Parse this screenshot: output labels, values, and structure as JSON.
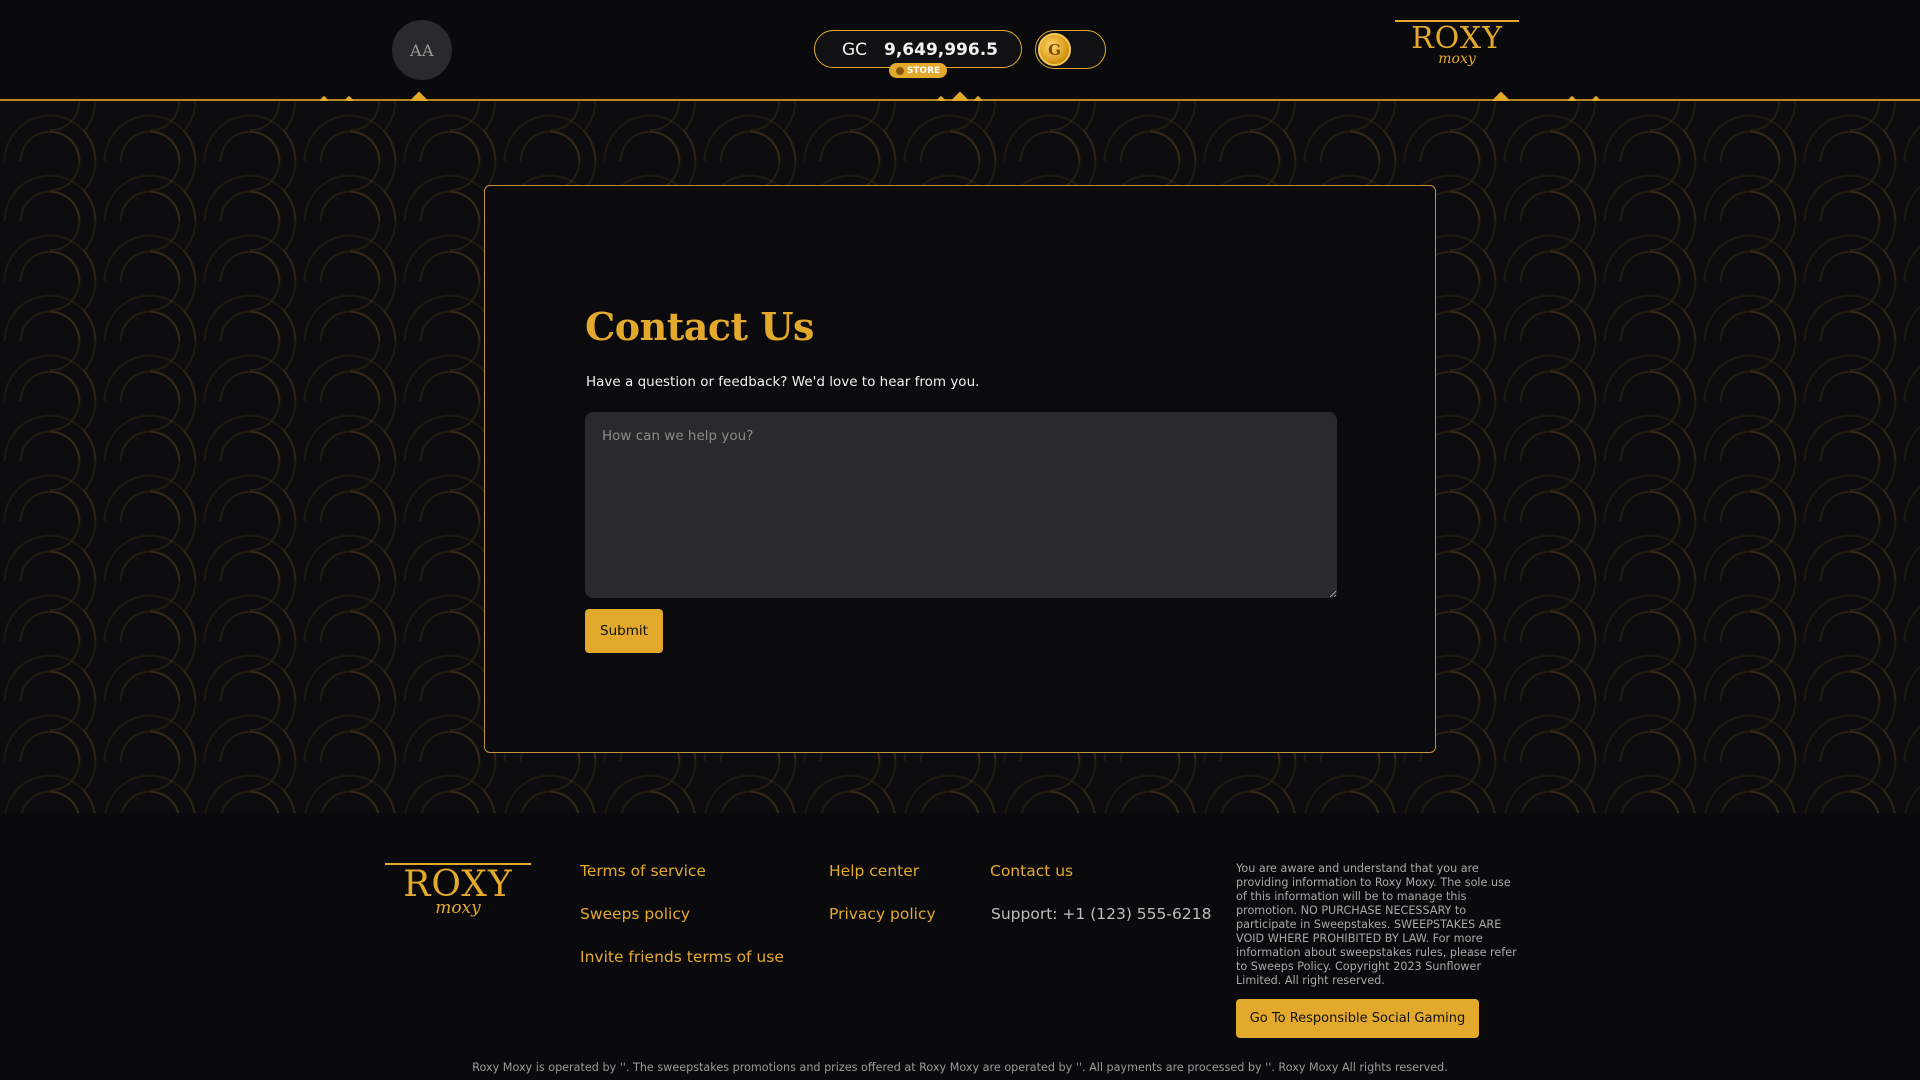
{
  "header": {
    "avatar_initials": "AA",
    "balance": {
      "currency": "GC",
      "value": "9,649,996.5",
      "store_label": "STORE"
    },
    "toggle_coin_letter": "G",
    "logo": {
      "top": "ROXY",
      "bottom": "moxy"
    }
  },
  "contact": {
    "title": "Contact Us",
    "subtitle": "Have a question or feedback? We'd love to hear from you.",
    "message_placeholder": "How can we help you?",
    "submit_label": "Submit"
  },
  "footer": {
    "logo": {
      "top": "ROXY",
      "bottom": "moxy"
    },
    "links": {
      "terms_of_service": "Terms of service",
      "sweeps_policy": "Sweeps policy",
      "invite_friends_terms": "Invite friends terms of use",
      "help_center": "Help center",
      "privacy_policy": "Privacy policy",
      "contact_us": "Contact us"
    },
    "support": "Support: +1 (123) 555-6218",
    "disclaimer": "You are aware and understand that you are providing information to Roxy Moxy. The sole use of this information will be to manage this promotion. NO PURCHASE NECESSARY to participate in Sweepstakes. SWEEPSTAKES ARE VOID WHERE PROHIBITED BY LAW. For more information about sweepstakes rules, please refer to Sweeps Policy. Copyright 2023 Sunflower Limited. All right reserved.",
    "responsible_gaming_label": "Go To Responsible Social Gaming",
    "legal": "Roxy Moxy is operated by ''. The sweepstakes promotions and prizes offered at Roxy Moxy are operated by ''. All payments are processed by ''. Roxy Moxy All rights reserved."
  },
  "colors": {
    "accent": "#e3a92c",
    "background": "#0a0a0c",
    "input_background": "#2a2a2c"
  }
}
